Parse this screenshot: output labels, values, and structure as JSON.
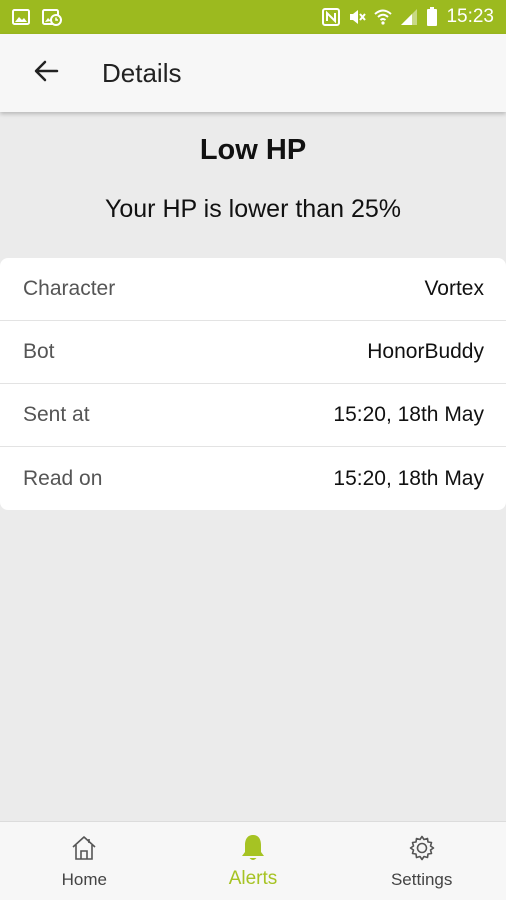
{
  "status_bar": {
    "time": "15:23",
    "bg_color": "#9cba1f",
    "left_icons": [
      "image-icon",
      "image-clock-icon"
    ],
    "right_icons": [
      "nfc-icon",
      "mute-icon",
      "wifi-icon",
      "signal-icon",
      "battery-icon"
    ]
  },
  "app_bar": {
    "title": "Details",
    "back_icon": "arrow-left-icon"
  },
  "alert": {
    "title": "Low HP",
    "message": "Your HP is lower than 25%"
  },
  "details": [
    {
      "label": "Character",
      "value": "Vortex"
    },
    {
      "label": "Bot",
      "value": "HonorBuddy"
    },
    {
      "label": "Sent at",
      "value": "15:20, 18th May"
    },
    {
      "label": "Read on",
      "value": "15:20, 18th May"
    }
  ],
  "bottom_nav": {
    "active_color": "#a6c323",
    "items": [
      {
        "label": "Home",
        "icon": "home-icon",
        "active": false
      },
      {
        "label": "Alerts",
        "icon": "bell-icon",
        "active": true
      },
      {
        "label": "Settings",
        "icon": "gear-icon",
        "active": false
      }
    ]
  }
}
